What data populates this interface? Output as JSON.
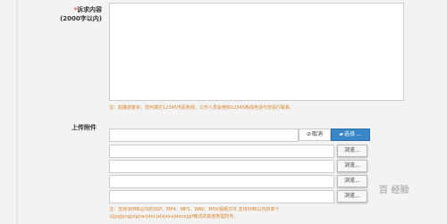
{
  "complaint": {
    "required_mark": "*",
    "label": "诉求内容",
    "sublabel": "(2000字以内)",
    "note": "注：如描述复杂，您可拨打12345市民热线，工作人员会使用12345热线电话与您进行联系。"
  },
  "upload": {
    "label": "上传附件",
    "cancel_label": "取消",
    "select_label": "选择 ...",
    "browse_labels": [
      "浏览...",
      "浏览...",
      "浏览...",
      "浏览..."
    ],
    "note_line1": "注：支持30MB以内的3GP、MP4、MP3、WAV、MOV视频文件,支持5MB以内的单个",
    "note_line2": "以jpg|png|zip|rar|doc|xls|xlsx|docx|gif格式的其他类型附件。"
  },
  "watermark": "百 经验"
}
